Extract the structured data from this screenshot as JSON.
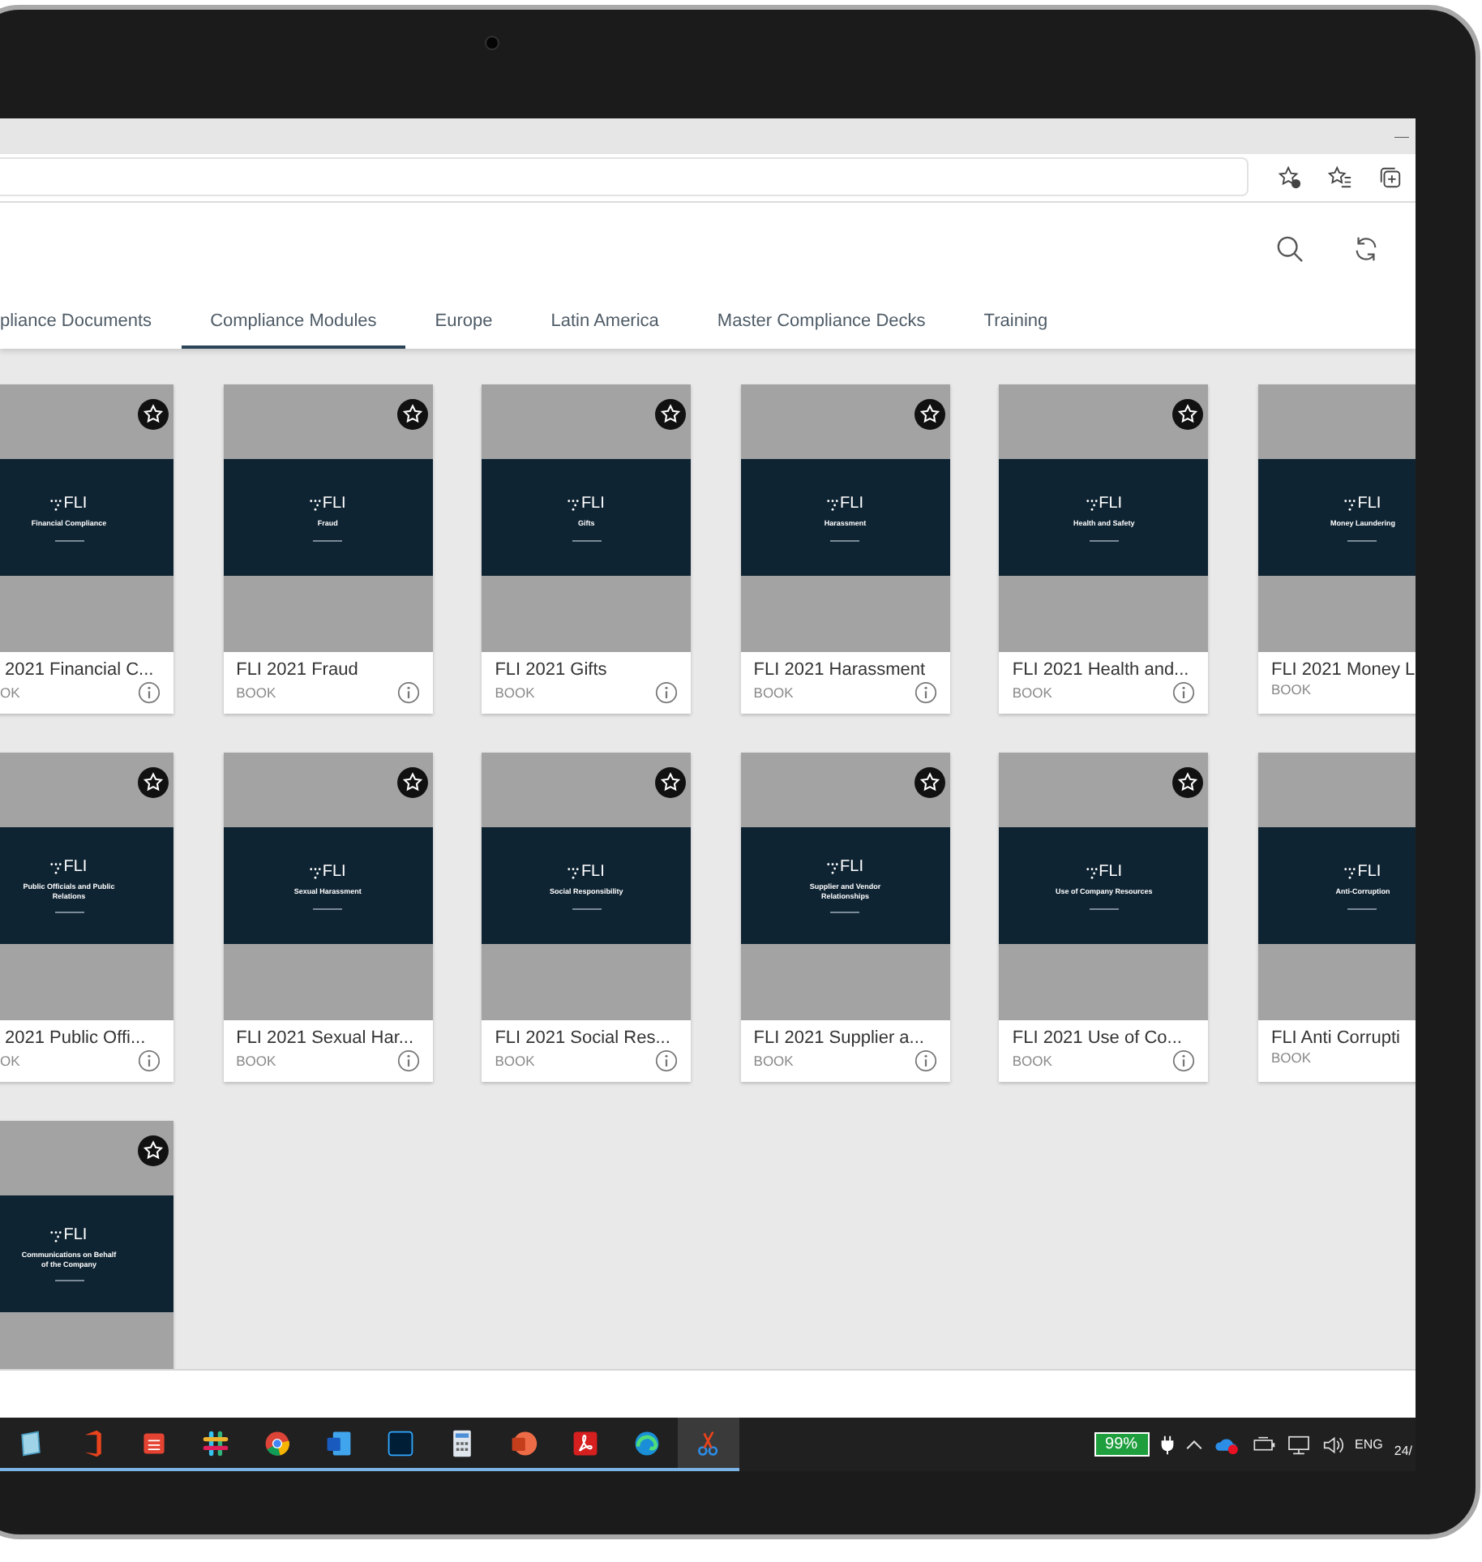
{
  "browser": {
    "minimize": "—"
  },
  "tabs": [
    {
      "label": "pliance Documents",
      "selected": false
    },
    {
      "label": "Compliance Modules",
      "selected": true
    },
    {
      "label": "Europe",
      "selected": false
    },
    {
      "label": "Latin America",
      "selected": false
    },
    {
      "label": "Master Compliance Decks",
      "selected": false
    },
    {
      "label": "Training",
      "selected": false
    }
  ],
  "cards": [
    {
      "kind": "cut-left",
      "title": "2021 Financial C...",
      "type": "OK",
      "cover": {
        "logo": "FLI",
        "subtitle": "Financial Compliance"
      }
    },
    {
      "kind": "full",
      "title": "FLI 2021 Fraud",
      "type": "BOOK",
      "cover": {
        "logo": "FLI",
        "subtitle": "Fraud"
      }
    },
    {
      "kind": "full",
      "title": "FLI 2021 Gifts",
      "type": "BOOK",
      "cover": {
        "logo": "FLI",
        "subtitle": "Gifts"
      }
    },
    {
      "kind": "full",
      "title": "FLI 2021 Harassment",
      "type": "BOOK",
      "cover": {
        "logo": "FLI",
        "subtitle": "Harassment"
      }
    },
    {
      "kind": "full",
      "title": "FLI 2021 Health and...",
      "type": "BOOK",
      "cover": {
        "logo": "FLI",
        "subtitle": "Health and Safety"
      }
    },
    {
      "kind": "cut-right",
      "title": "FLI 2021 Money L",
      "type": "BOOK",
      "cover": {
        "logo": "FLI",
        "subtitle": "Money Laundering"
      }
    },
    {
      "kind": "cut-left",
      "title": "2021 Public Offi...",
      "type": "OK",
      "cover": {
        "logo": "FLI",
        "subtitle": "Public Officials and Public Relations"
      }
    },
    {
      "kind": "full",
      "title": "FLI 2021 Sexual Har...",
      "type": "BOOK",
      "cover": {
        "logo": "FLI",
        "subtitle": "Sexual Harassment"
      }
    },
    {
      "kind": "full",
      "title": "FLI 2021 Social Res...",
      "type": "BOOK",
      "cover": {
        "logo": "FLI",
        "subtitle": "Social Responsibility"
      }
    },
    {
      "kind": "full",
      "title": "FLI 2021 Supplier a...",
      "type": "BOOK",
      "cover": {
        "logo": "FLI",
        "subtitle": "Supplier and Vendor Relationships"
      }
    },
    {
      "kind": "full",
      "title": "FLI 2021 Use of Co...",
      "type": "BOOK",
      "cover": {
        "logo": "FLI",
        "subtitle": "Use of Company Resources"
      }
    },
    {
      "kind": "cut-right",
      "title": "FLI Anti Corrupti",
      "type": "BOOK",
      "cover": {
        "logo": "FLI",
        "subtitle": "Anti-Corruption"
      }
    },
    {
      "kind": "cut-left",
      "cover": {
        "logo": "FLI",
        "subtitle": "Communications on Behalf of the Company"
      }
    }
  ],
  "taskbar": {
    "apps": [
      {
        "kind": "notepad",
        "selected": false
      },
      {
        "kind": "office",
        "selected": false
      },
      {
        "kind": "tasks",
        "selected": false
      },
      {
        "kind": "slack",
        "selected": false
      },
      {
        "kind": "chrome",
        "selected": false
      },
      {
        "kind": "word",
        "selected": false
      },
      {
        "kind": "photoshop",
        "selected": false
      },
      {
        "kind": "calculator",
        "selected": false
      },
      {
        "kind": "powerpoint",
        "selected": false
      },
      {
        "kind": "acrobat",
        "selected": false
      },
      {
        "kind": "edge",
        "selected": false
      },
      {
        "kind": "snip",
        "selected": true
      }
    ],
    "battery": "99%",
    "language": "ENG",
    "clock": "24/"
  }
}
